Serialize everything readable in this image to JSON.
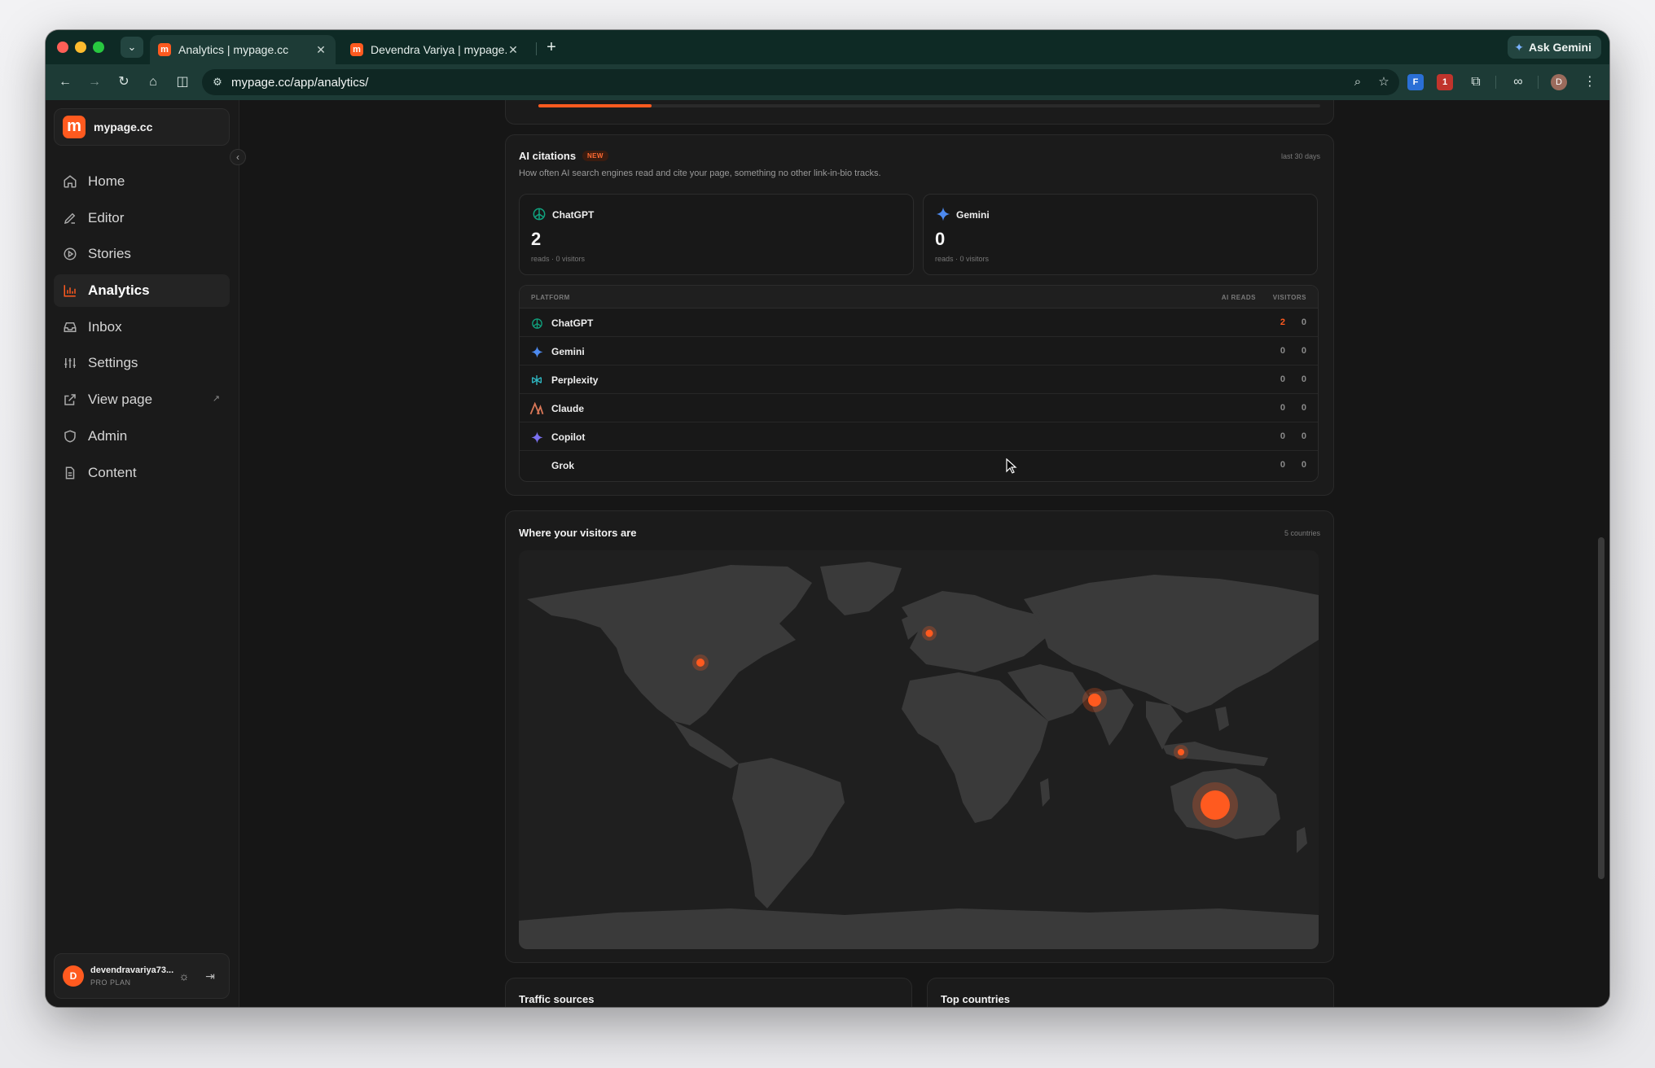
{
  "browser": {
    "tabs": [
      {
        "title": "Analytics | mypage.cc",
        "favicon": "m"
      },
      {
        "title": "Devendra Variya | mypage.cc",
        "favicon": "m"
      }
    ],
    "ask_gemini": "Ask Gemini",
    "url": "mypage.cc/app/analytics/",
    "profile_initial": "D",
    "extension_badge": "1"
  },
  "sidebar": {
    "brand": "mypage.cc",
    "brand_logo": "m",
    "items": [
      {
        "label": "Home",
        "icon": "home-icon"
      },
      {
        "label": "Editor",
        "icon": "pen-icon"
      },
      {
        "label": "Stories",
        "icon": "play-circle-icon"
      },
      {
        "label": "Analytics",
        "icon": "bar-chart-icon"
      },
      {
        "label": "Inbox",
        "icon": "inbox-icon"
      },
      {
        "label": "Settings",
        "icon": "sliders-icon"
      },
      {
        "label": "View page",
        "icon": "external-link-icon"
      },
      {
        "label": "Admin",
        "icon": "shield-icon"
      },
      {
        "label": "Content",
        "icon": "document-icon"
      }
    ],
    "active": "Analytics",
    "user": {
      "initial": "D",
      "name": "devendravariya73...",
      "plan": "PRO PLAN"
    }
  },
  "colors": {
    "accent": "#ff5a1f",
    "background": "#161616",
    "card": "#1b1b1b"
  },
  "top_progress": 0.145,
  "ai_citations": {
    "title": "AI citations",
    "badge": "NEW",
    "period": "last 30 days",
    "subtitle": "How often AI search engines read and cite your page, something no other link-in-bio tracks.",
    "stats": [
      {
        "name": "ChatGPT",
        "value": "2",
        "foot": "reads · 0 visitors"
      },
      {
        "name": "Gemini",
        "value": "0",
        "foot": "reads · 0 visitors"
      }
    ],
    "table": {
      "headers": {
        "platform": "PLATFORM",
        "reads": "AI READS",
        "visitors": "VISITORS"
      },
      "rows": [
        {
          "name": "ChatGPT",
          "reads": "2",
          "visitors": "0",
          "icon": "chatgpt-icon"
        },
        {
          "name": "Gemini",
          "reads": "0",
          "visitors": "0",
          "icon": "gemini-icon"
        },
        {
          "name": "Perplexity",
          "reads": "0",
          "visitors": "0",
          "icon": "perplexity-icon"
        },
        {
          "name": "Claude",
          "reads": "0",
          "visitors": "0",
          "icon": "claude-icon"
        },
        {
          "name": "Copilot",
          "reads": "0",
          "visitors": "0",
          "icon": "copilot-icon"
        },
        {
          "name": "Grok",
          "reads": "0",
          "visitors": "0",
          "icon": "grok-icon"
        }
      ]
    }
  },
  "visitors_map": {
    "title": "Where your visitors are",
    "meta": "5 countries"
  },
  "bottom_cards": {
    "traffic": "Traffic sources",
    "countries": "Top countries"
  }
}
